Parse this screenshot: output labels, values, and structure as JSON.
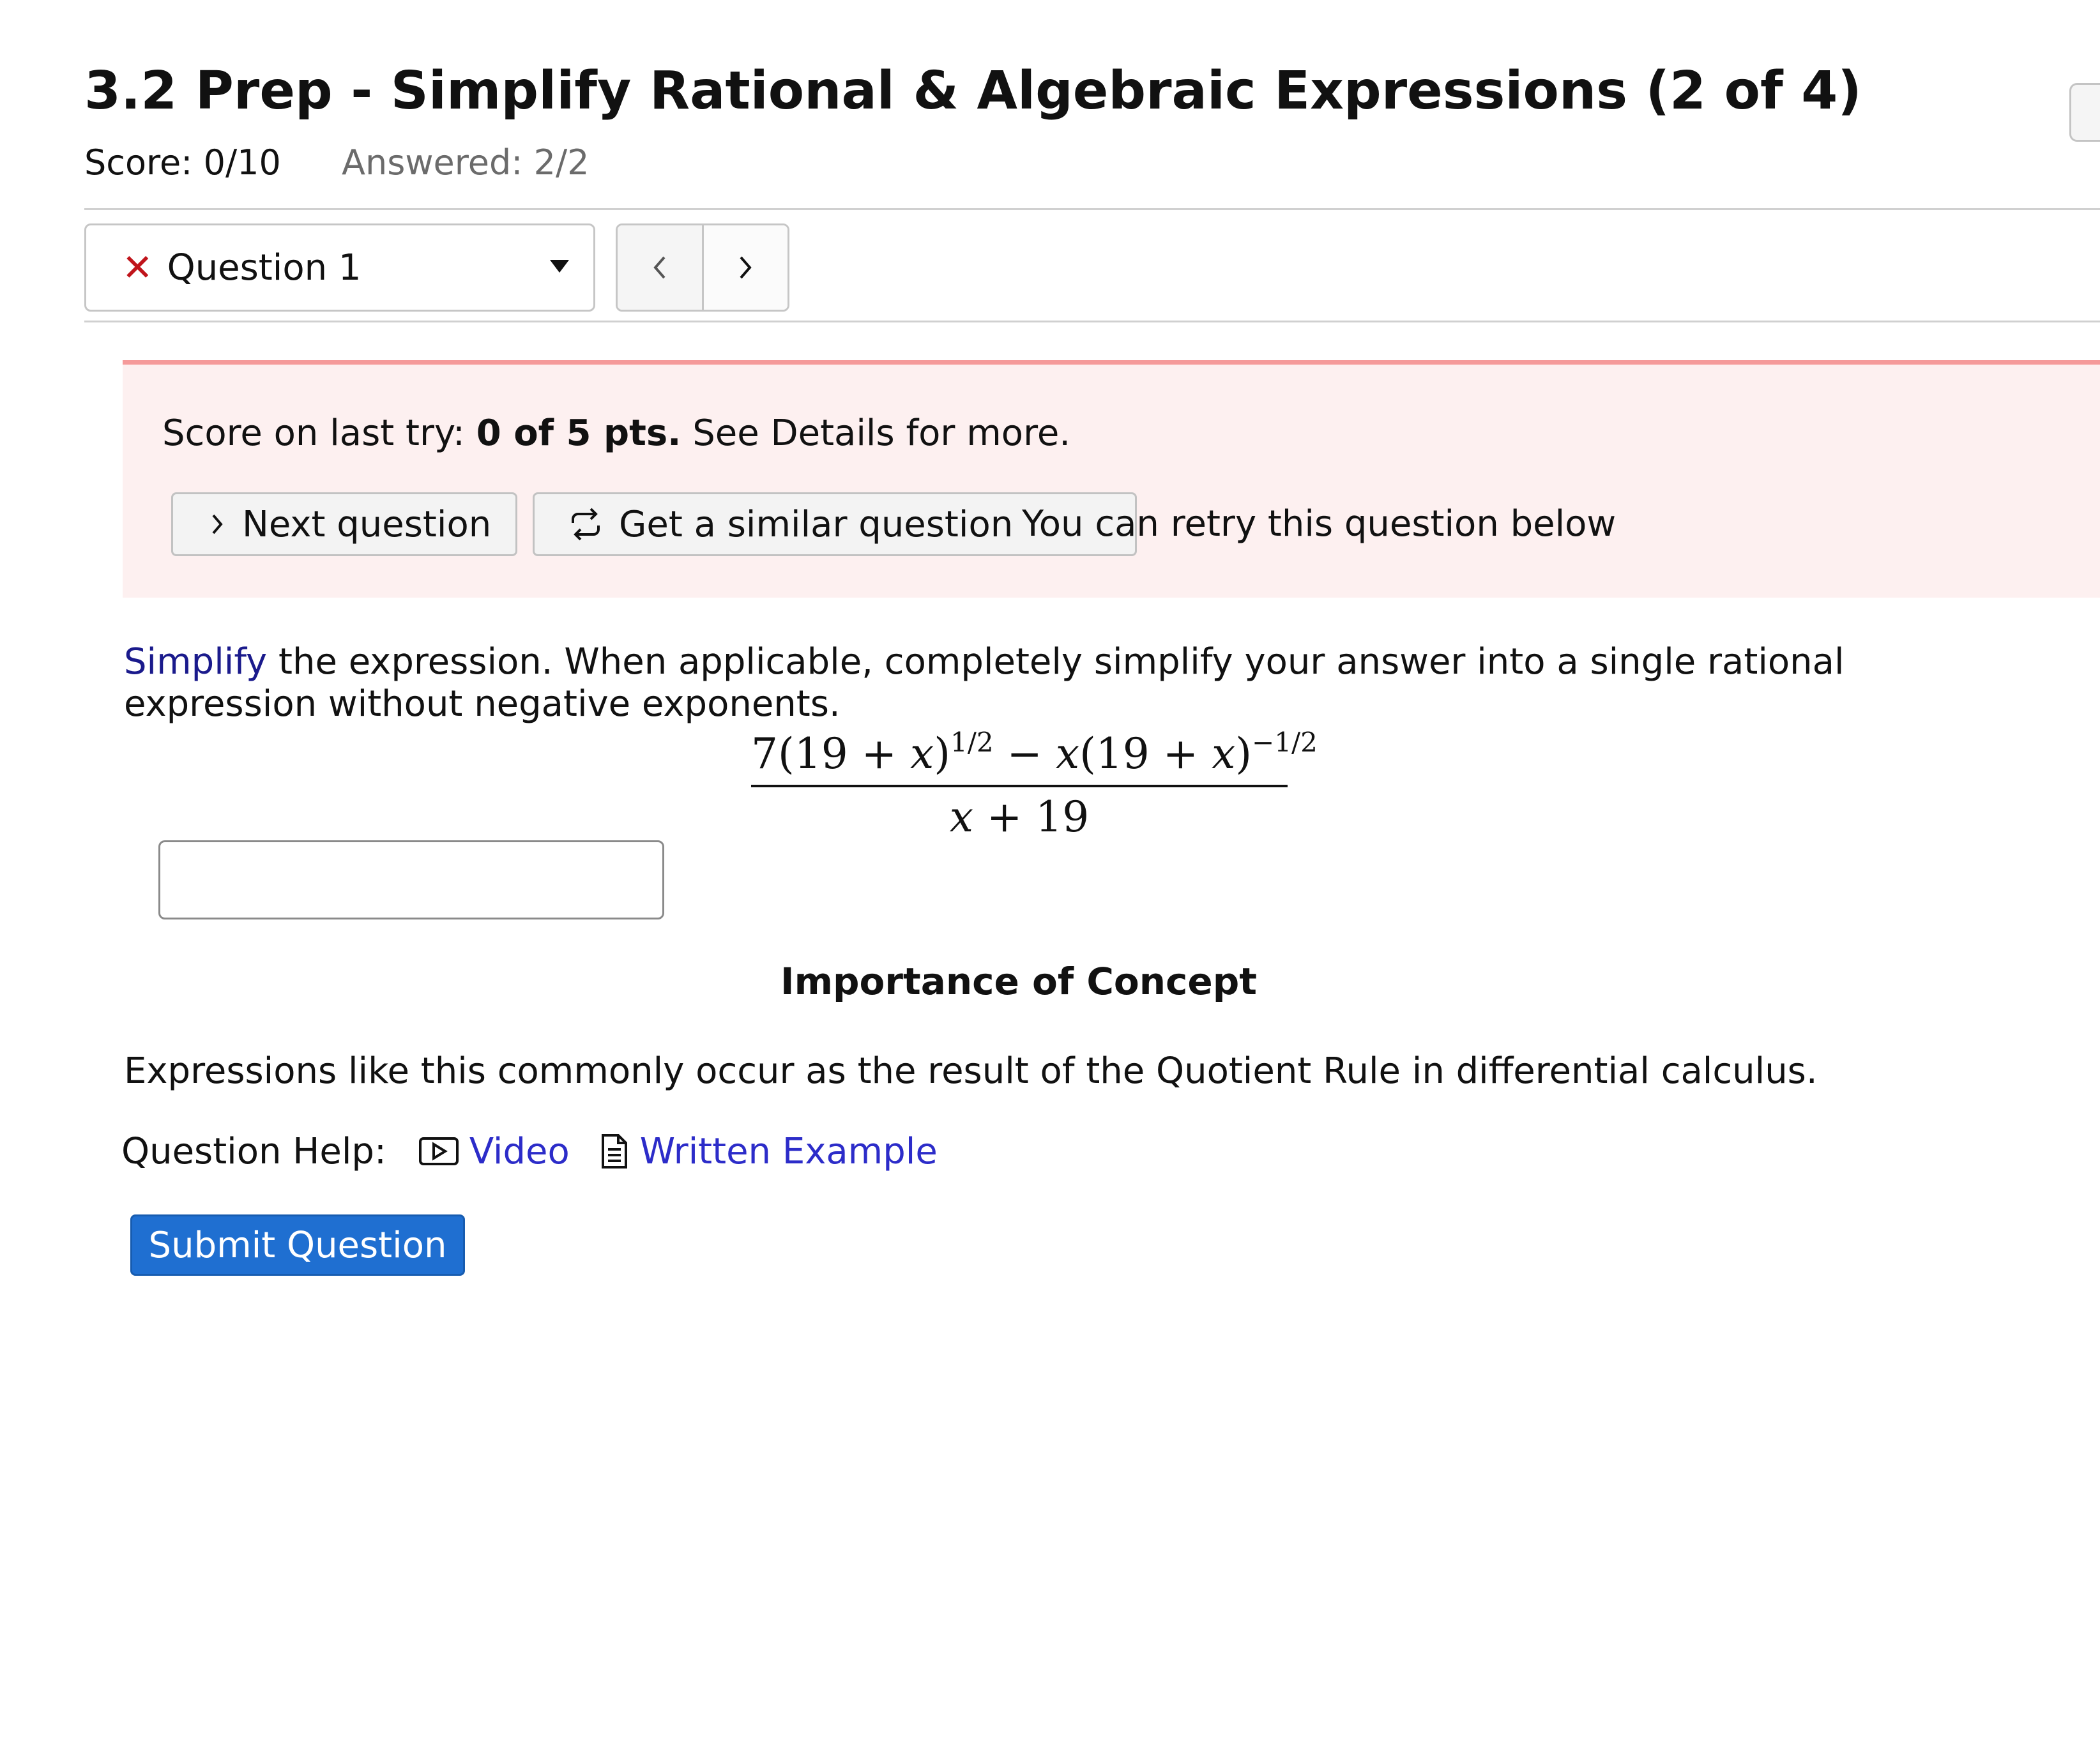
{
  "header": {
    "title": "3.2 Prep - Simplify Rational & Algebraic Expressions (2 of 4)",
    "score": "Score: 0/10",
    "answered": "Answered: 2/2"
  },
  "question_nav": {
    "selected_label": "Question 1",
    "status_icon": "x-icon",
    "prev_icon": "chevron-left-icon",
    "next_icon": "chevron-right-icon"
  },
  "alert": {
    "score_prefix": "Score on last try: ",
    "score_value": "0 of 5 pts.",
    "score_suffix": " See Details for more.",
    "next_button_label": "Next question",
    "similar_button_label": "Get a similar question",
    "retry_text": "You can retry this question below",
    "background_color": "#fdf0f0",
    "border_color": "#f59a9a"
  },
  "question": {
    "keyword": "Simplify",
    "text": " the expression. When applicable, completely simplify your answer into a single rational expression without negative exponents.",
    "expression": {
      "num_part1": "7(19 + ",
      "var": "x",
      "num_part2": ")",
      "exp1": "1/2",
      "num_part3": " − ",
      "num_part4": "(19 + ",
      "num_part5": ")",
      "exp2": "−1/2",
      "den_part2": " + 19"
    },
    "answer_value": "",
    "answer_placeholder": ""
  },
  "concept": {
    "title": "Importance of Concept",
    "text": "Expressions like this commonly occur as the result of the Quotient Rule in differential calculus."
  },
  "help": {
    "label": "Question Help:",
    "video_label": "Video",
    "written_label": "Written Example",
    "link_color": "#2c2cc9"
  },
  "submit": {
    "label": "Submit Question",
    "color": "#1f6fd1"
  }
}
